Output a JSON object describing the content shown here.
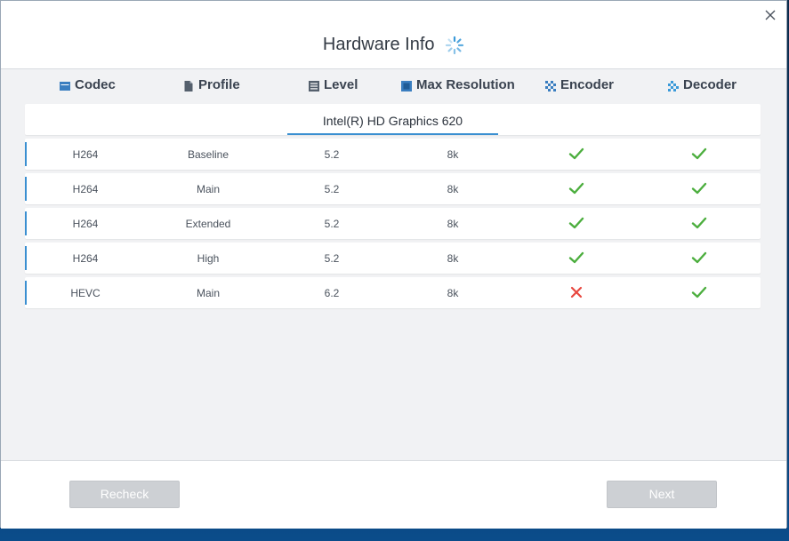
{
  "dialog": {
    "title": "Hardware Info",
    "close_icon": "close-icon",
    "spinner_icon": "loading-spinner-icon"
  },
  "columns": [
    {
      "label": "Codec",
      "icon": "codec-icon"
    },
    {
      "label": "Profile",
      "icon": "document-icon"
    },
    {
      "label": "Level",
      "icon": "list-icon"
    },
    {
      "label": "Max Resolution",
      "icon": "resolution-icon"
    },
    {
      "label": "Encoder",
      "icon": "encoder-icon"
    },
    {
      "label": "Decoder",
      "icon": "decoder-icon"
    }
  ],
  "device": {
    "name": "Intel(R) HD Graphics 620"
  },
  "rows": [
    {
      "codec": "H264",
      "profile": "Baseline",
      "level": "5.2",
      "max_resolution": "8k",
      "encoder": true,
      "decoder": true
    },
    {
      "codec": "H264",
      "profile": "Main",
      "level": "5.2",
      "max_resolution": "8k",
      "encoder": true,
      "decoder": true
    },
    {
      "codec": "H264",
      "profile": "Extended",
      "level": "5.2",
      "max_resolution": "8k",
      "encoder": true,
      "decoder": true
    },
    {
      "codec": "H264",
      "profile": "High",
      "level": "5.2",
      "max_resolution": "8k",
      "encoder": true,
      "decoder": true
    },
    {
      "codec": "HEVC",
      "profile": "Main",
      "level": "6.2",
      "max_resolution": "8k",
      "encoder": false,
      "decoder": true
    }
  ],
  "buttons": {
    "recheck_label": "Recheck",
    "next_label": "Next"
  },
  "colors": {
    "accent": "#3a8fd1",
    "check": "#4cae3e",
    "cross": "#e8473f",
    "button_disabled": "#cdd0d4"
  }
}
